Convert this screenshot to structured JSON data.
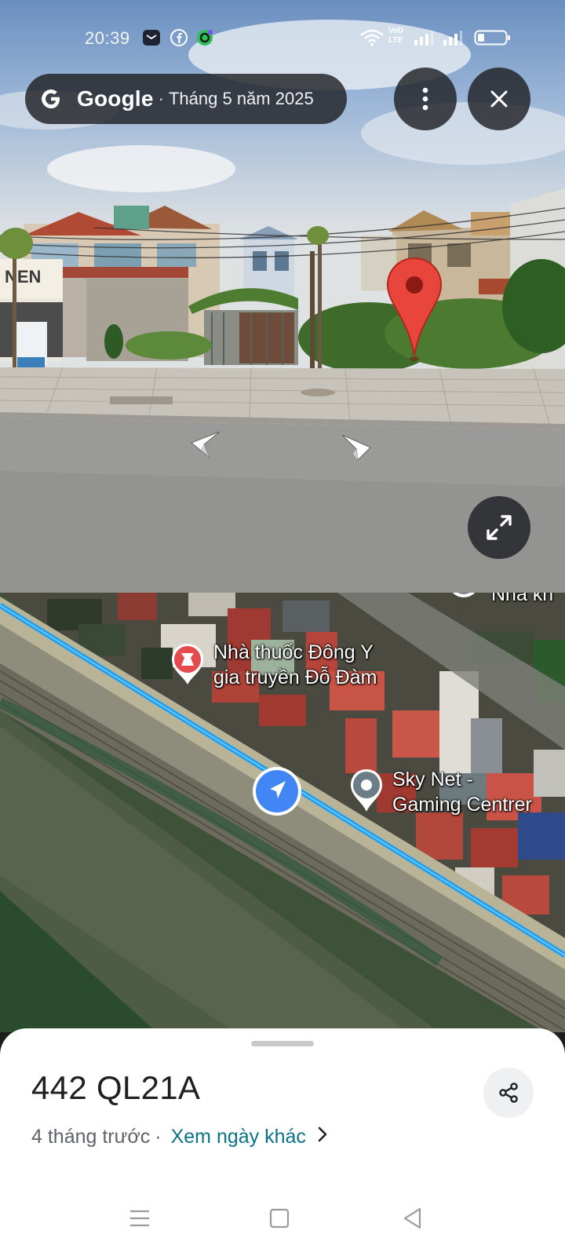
{
  "status_bar": {
    "time": "20:39",
    "left_icons": [
      "mail-icon",
      "facebook-icon",
      "app-icon"
    ],
    "right_icons": [
      "wifi-icon",
      "volte-icon",
      "signal-icon",
      "signal-icon",
      "battery-icon"
    ],
    "network_label_top": "VoD",
    "network_label_bottom": "LTE"
  },
  "street_view": {
    "brand": "Google",
    "separator": "·",
    "capture_date": "Tháng 5 năm 2025",
    "more_button_icon": "more-vert-icon",
    "close_button_icon": "close-icon",
    "expand_button_icon": "expand-icon",
    "pin_icon": "red-pin-icon",
    "arrows": [
      "chevron-left-icon",
      "chevron-right-icon"
    ],
    "shop_sign_text": "NEN"
  },
  "map": {
    "labels": {
      "pharmacy_line1": "Nhà thuốc Đông Y",
      "pharmacy_line2": "gia truyền Đỗ Đàm",
      "gaming_line1": "Sky Net -",
      "gaming_line2": "Gaming Centrer",
      "top_cut": "Nhà kh"
    },
    "route_color": "#1ea1f2",
    "location_marker_color": "#4285f4"
  },
  "sheet": {
    "title": "442 QL21A",
    "age": "4 tháng trước",
    "dot": "·",
    "link": "Xem ngày khác",
    "chevron": "›"
  },
  "nav_bar": {
    "icons": [
      "menu-icon",
      "home-square-icon",
      "back-triangle-icon"
    ]
  }
}
